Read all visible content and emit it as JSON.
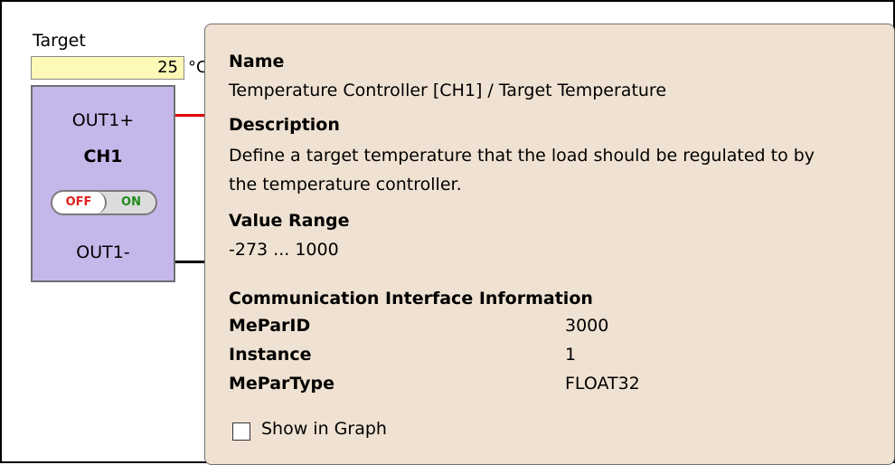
{
  "target": {
    "label": "Target",
    "value": "25",
    "unit": "°C"
  },
  "channel": {
    "out_plus": "OUT1+",
    "name": "CH1",
    "toggle_off": "OFF",
    "toggle_on": "ON",
    "out_minus": "OUT1-"
  },
  "tooltip": {
    "name_heading": "Name",
    "name_value": "Temperature Controller [CH1] / Target Temperature",
    "description_heading": "Description",
    "description_line1": "Define a target temperature that the load should be regulated to by",
    "description_line2": "the temperature controller.",
    "range_heading": "Value Range",
    "range_value": "-273 ... 1000",
    "comm_heading": "Communication Interface Information",
    "rows": [
      {
        "label": "MeParID",
        "value": "3000"
      },
      {
        "label": "Instance",
        "value": "1"
      },
      {
        "label": "MeParType",
        "value": "FLOAT32"
      }
    ],
    "show_in_graph_label": "Show in Graph"
  },
  "colors": {
    "target_input_bg": "#fdf9b6",
    "channel_bg": "#c6b7ea",
    "tooltip_bg": "#f0e2d2",
    "wire_positive": "#e00000",
    "wire_negative": "#000000",
    "toggle_off": "#e02020",
    "toggle_on": "#1f8a1f"
  }
}
